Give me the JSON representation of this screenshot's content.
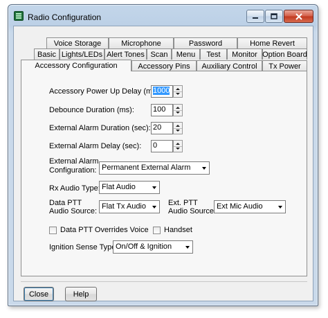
{
  "window": {
    "title": "Radio Configuration"
  },
  "tabs": {
    "row1": [
      "Voice Storage",
      "Microphone",
      "Password",
      "Home Revert"
    ],
    "row2": [
      "Basic",
      "Lights/LEDs",
      "Alert Tones",
      "Scan",
      "Menu",
      "Test",
      "Monitor",
      "Option Board"
    ],
    "row3": [
      "Accessory Configuration",
      "Accessory Pins",
      "Auxiliary Control",
      "Tx Power"
    ],
    "selected": "Accessory Configuration"
  },
  "form": {
    "accessory_power_up_delay": {
      "label": "Accessory Power Up Delay (ms):",
      "value": "1000"
    },
    "debounce_duration": {
      "label": "Debounce Duration (ms):",
      "value": "100"
    },
    "external_alarm_duration": {
      "label": "External Alarm Duration (sec):",
      "value": "20"
    },
    "external_alarm_delay": {
      "label": "External Alarm Delay (sec):",
      "value": "0"
    },
    "external_alarm_configuration": {
      "label_line1": "External Alarm",
      "label_line2": "Configuration:",
      "value": "Permanent External Alarm"
    },
    "rx_audio_type": {
      "label": "Rx Audio Type:",
      "value": "Flat Audio"
    },
    "data_ptt_audio_source": {
      "label_line1": "Data PTT",
      "label_line2": "Audio Source:",
      "value": "Flat Tx Audio"
    },
    "ext_ptt_audio_source": {
      "label_line1": "Ext. PTT",
      "label_line2": "Audio Source:",
      "value": "Ext Mic Audio"
    },
    "data_ptt_overrides_voice": {
      "label": "Data PTT Overrides Voice",
      "checked": false
    },
    "handset": {
      "label": "Handset",
      "checked": false
    },
    "ignition_sense_type": {
      "label": "Ignition Sense Type:",
      "value": "On/Off & Ignition"
    }
  },
  "footer": {
    "close_label": "Close",
    "help_label": "Help"
  },
  "colors": {
    "selection": "#3399ff",
    "title_accent": "#c0391f"
  },
  "icons": {
    "app": "radio-config-app-icon",
    "minimize": "minimize-icon",
    "maximize": "maximize-icon",
    "close": "close-icon"
  }
}
